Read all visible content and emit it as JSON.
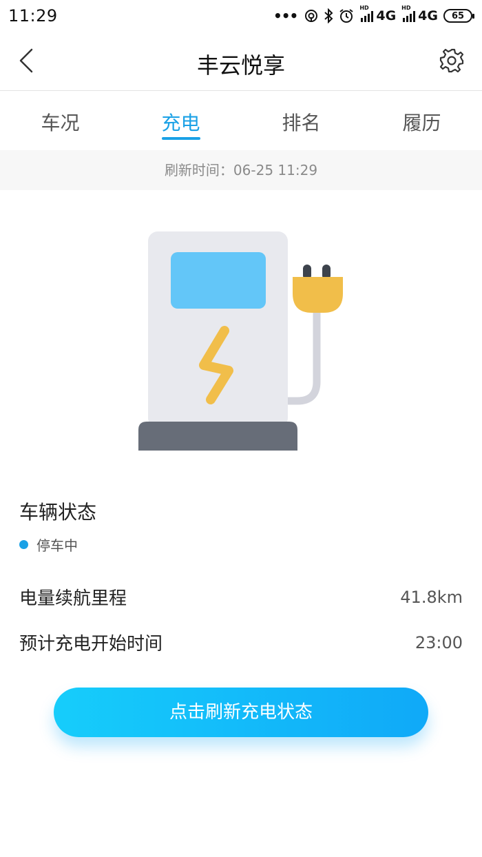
{
  "status_bar": {
    "time": "11:29",
    "dots": "•••",
    "network1": "4G",
    "network2": "4G",
    "network_hd": "HD",
    "battery": "65"
  },
  "header": {
    "title": "丰云悦享",
    "back_icon": "chevron-left-icon",
    "settings_icon": "gear-icon"
  },
  "tabs": [
    {
      "label": "车况",
      "active": false
    },
    {
      "label": "充电",
      "active": true
    },
    {
      "label": "排名",
      "active": false
    },
    {
      "label": "履历",
      "active": false
    }
  ],
  "refresh": {
    "text": "刷新时间：06-25 11:29"
  },
  "illustration": {
    "icon": "charging-station-icon",
    "colors": {
      "body": "#e8e9ee",
      "screen": "#63c6f8",
      "bolt": "#f1be4a",
      "plug": "#f1be4a",
      "prongs": "#3d434c",
      "cable": "#d3d4dc",
      "base": "#676d78"
    }
  },
  "vehicle": {
    "section_title": "车辆状态",
    "status": "停车中",
    "status_color": "#1aa1e6",
    "rows": [
      {
        "label": "电量续航里程",
        "value": "41.8km"
      },
      {
        "label": "预计充电开始时间",
        "value": "23:00"
      }
    ]
  },
  "action": {
    "button_label": "点击刷新充电状态",
    "accent": "#10a9f8"
  }
}
